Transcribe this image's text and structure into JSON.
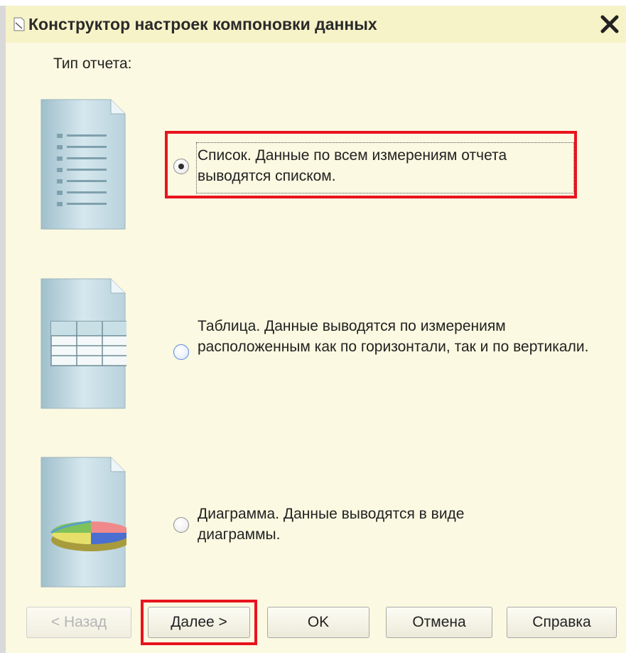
{
  "window": {
    "title": "Конструктор настроек компоновки данных",
    "icon": "wizard-icon",
    "close_icon": "close-icon"
  },
  "section_label": "Тип отчета:",
  "options": [
    {
      "id": "list",
      "text": "Список. Данные по всем измерениям отчета выводятся списком.",
      "selected": true,
      "icon": "list-document-icon"
    },
    {
      "id": "table",
      "text": "Таблица. Данные выводятся по измерениям расположенным как по горизонтали, так и по вертикали.",
      "selected": false,
      "icon": "table-document-icon"
    },
    {
      "id": "chart",
      "text": "Диаграмма. Данные выводятся в виде диаграммы.",
      "selected": false,
      "icon": "chart-document-icon"
    }
  ],
  "buttons": {
    "back": {
      "label": "< Назад",
      "enabled": false
    },
    "next": {
      "label": "Далее >",
      "enabled": true
    },
    "ok": {
      "label": "OK",
      "enabled": true
    },
    "cancel": {
      "label": "Отмена",
      "enabled": true
    },
    "help": {
      "label": "Справка",
      "enabled": true
    }
  },
  "colors": {
    "dialog_bg": "#fbf9e1",
    "title_bg": "#f7f3c8",
    "highlight": "#e8141e"
  }
}
